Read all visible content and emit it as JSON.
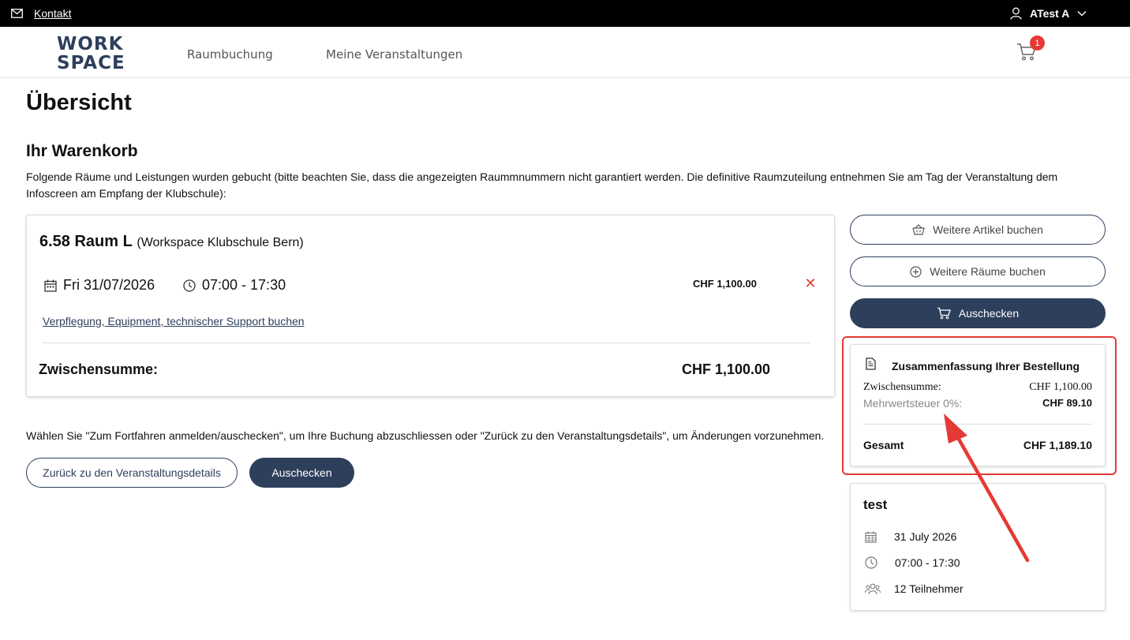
{
  "topbar": {
    "contact_label": "Kontakt",
    "user_name": "ATest A"
  },
  "header": {
    "logo_line1": "WORK",
    "logo_line2": "SPACE",
    "nav": [
      "Raumbuchung",
      "Meine Veranstaltungen"
    ],
    "cart_count": "1"
  },
  "page": {
    "title": "Übersicht",
    "cart_title": "Ihr Warenkorb",
    "intro": "Folgende Räume und Leistungen wurden gebucht (bitte beachten Sie, dass die angezeigten Raummnummern nicht garantiert werden. Die definitive Raumzuteilung entnehmen Sie am Tag der Veranstaltung dem Infoscreen am Empfang der Klubschule):"
  },
  "booking": {
    "room_name": "6.58 Raum L",
    "location": "(Workspace Klubschule Bern)",
    "date": "Fri 31/07/2026",
    "time": "07:00 - 17:30",
    "price": "CHF 1,100.00",
    "remove_symbol": "✕",
    "service_link": "Verpflegung, Equipment, technischer Support buchen",
    "subtotal_label": "Zwischensumme:",
    "subtotal_value": "CHF 1,100.00"
  },
  "footer_note": "Wählen Sie \"Zum Fortfahren anmelden/auschecken\", um Ihre Buchung abzuschliessen oder \"Zurück zu den Veranstaltungsdetails\", um Änderungen vorzunehmen.",
  "buttons": {
    "back": "Zurück zu den Veranstaltungsdetails",
    "checkout": "Auschecken",
    "more_items": "Weitere Artikel buchen",
    "more_rooms": "Weitere Räume buchen",
    "checkout_side": "Auschecken"
  },
  "summary": {
    "title": "Zusammenfassung Ihrer Bestellung",
    "subtotal_label": "Zwischensumme:",
    "subtotal_value": "CHF 1,100.00",
    "vat_label": "Mehrwertsteuer 0%:",
    "vat_value": "CHF 89.10",
    "total_label": "Gesamt",
    "total_value": "CHF 1,189.10"
  },
  "event": {
    "title": "test",
    "date": "31 July 2026",
    "time": "07:00 - 17:30",
    "participants": "12 Teilnehmer"
  },
  "colors": {
    "accent": "#2e3f5c",
    "highlight": "#e53935"
  }
}
